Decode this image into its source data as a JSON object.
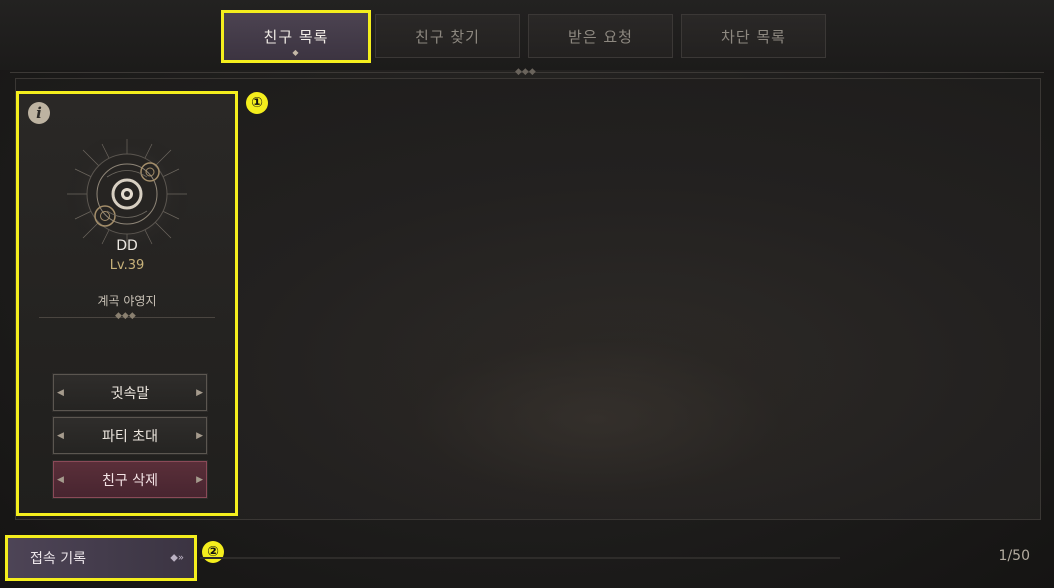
{
  "tabs": [
    {
      "label": "친구 목록",
      "active": true
    },
    {
      "label": "친구 찾기",
      "active": false
    },
    {
      "label": "받은 요청",
      "active": false
    },
    {
      "label": "차단 목록",
      "active": false
    }
  ],
  "friend_card": {
    "info_icon": "info-icon",
    "name": "DD",
    "level": "Lv.39",
    "location": "계곡 야영지",
    "buttons": {
      "whisper": "귓속말",
      "party_invite": "파티 초대",
      "remove_friend": "친구 삭제"
    }
  },
  "annotations": {
    "badge1": "①",
    "badge2": "②"
  },
  "footer": {
    "history_label": "접속 기록",
    "friend_count": "1/50"
  },
  "colors": {
    "highlight": "#f4ee1d",
    "active_tab": "#463d4b",
    "danger_button": "#5a2f39",
    "level_text": "#c8b27a"
  }
}
